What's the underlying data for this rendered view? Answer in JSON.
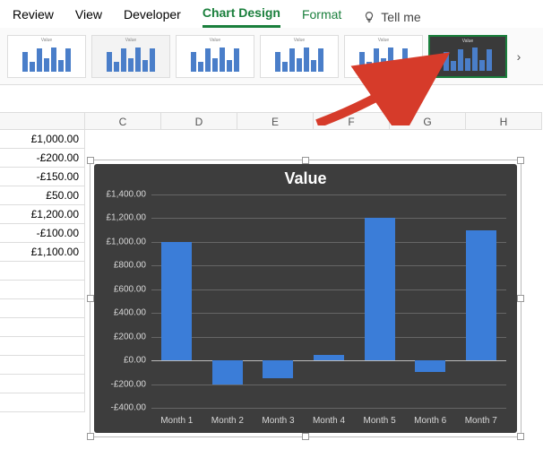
{
  "ribbon": {
    "tabs": [
      "Review",
      "View",
      "Developer",
      "Chart Design",
      "Format"
    ],
    "active_tab": "Chart Design",
    "tell_me": "Tell me"
  },
  "gallery": {
    "thumb_title": "Value",
    "next_glyph": "›"
  },
  "columns": [
    "C",
    "D",
    "E",
    "F",
    "G",
    "H"
  ],
  "col_b_width": 95,
  "data_cells": [
    "£1,000.00",
    "-£200.00",
    "-£150.00",
    "£50.00",
    "£1,200.00",
    "-£100.00",
    "£1,100.00"
  ],
  "chart_data": {
    "type": "bar",
    "title": "Value",
    "categories": [
      "Month 1",
      "Month 2",
      "Month 3",
      "Month 4",
      "Month 5",
      "Month 6",
      "Month 7"
    ],
    "values": [
      1000,
      -200,
      -150,
      50,
      1200,
      -100,
      1100
    ],
    "ylim": [
      -400,
      1400
    ],
    "yticks": [
      -400,
      -200,
      0,
      200,
      400,
      600,
      800,
      1000,
      1200,
      1400
    ],
    "ytick_labels": [
      "-£400.00",
      "-£200.00",
      "£0.00",
      "£200.00",
      "£400.00",
      "£600.00",
      "£800.00",
      "£1,000.00",
      "£1,200.00",
      "£1,400.00"
    ],
    "xlabel": "",
    "ylabel": ""
  }
}
